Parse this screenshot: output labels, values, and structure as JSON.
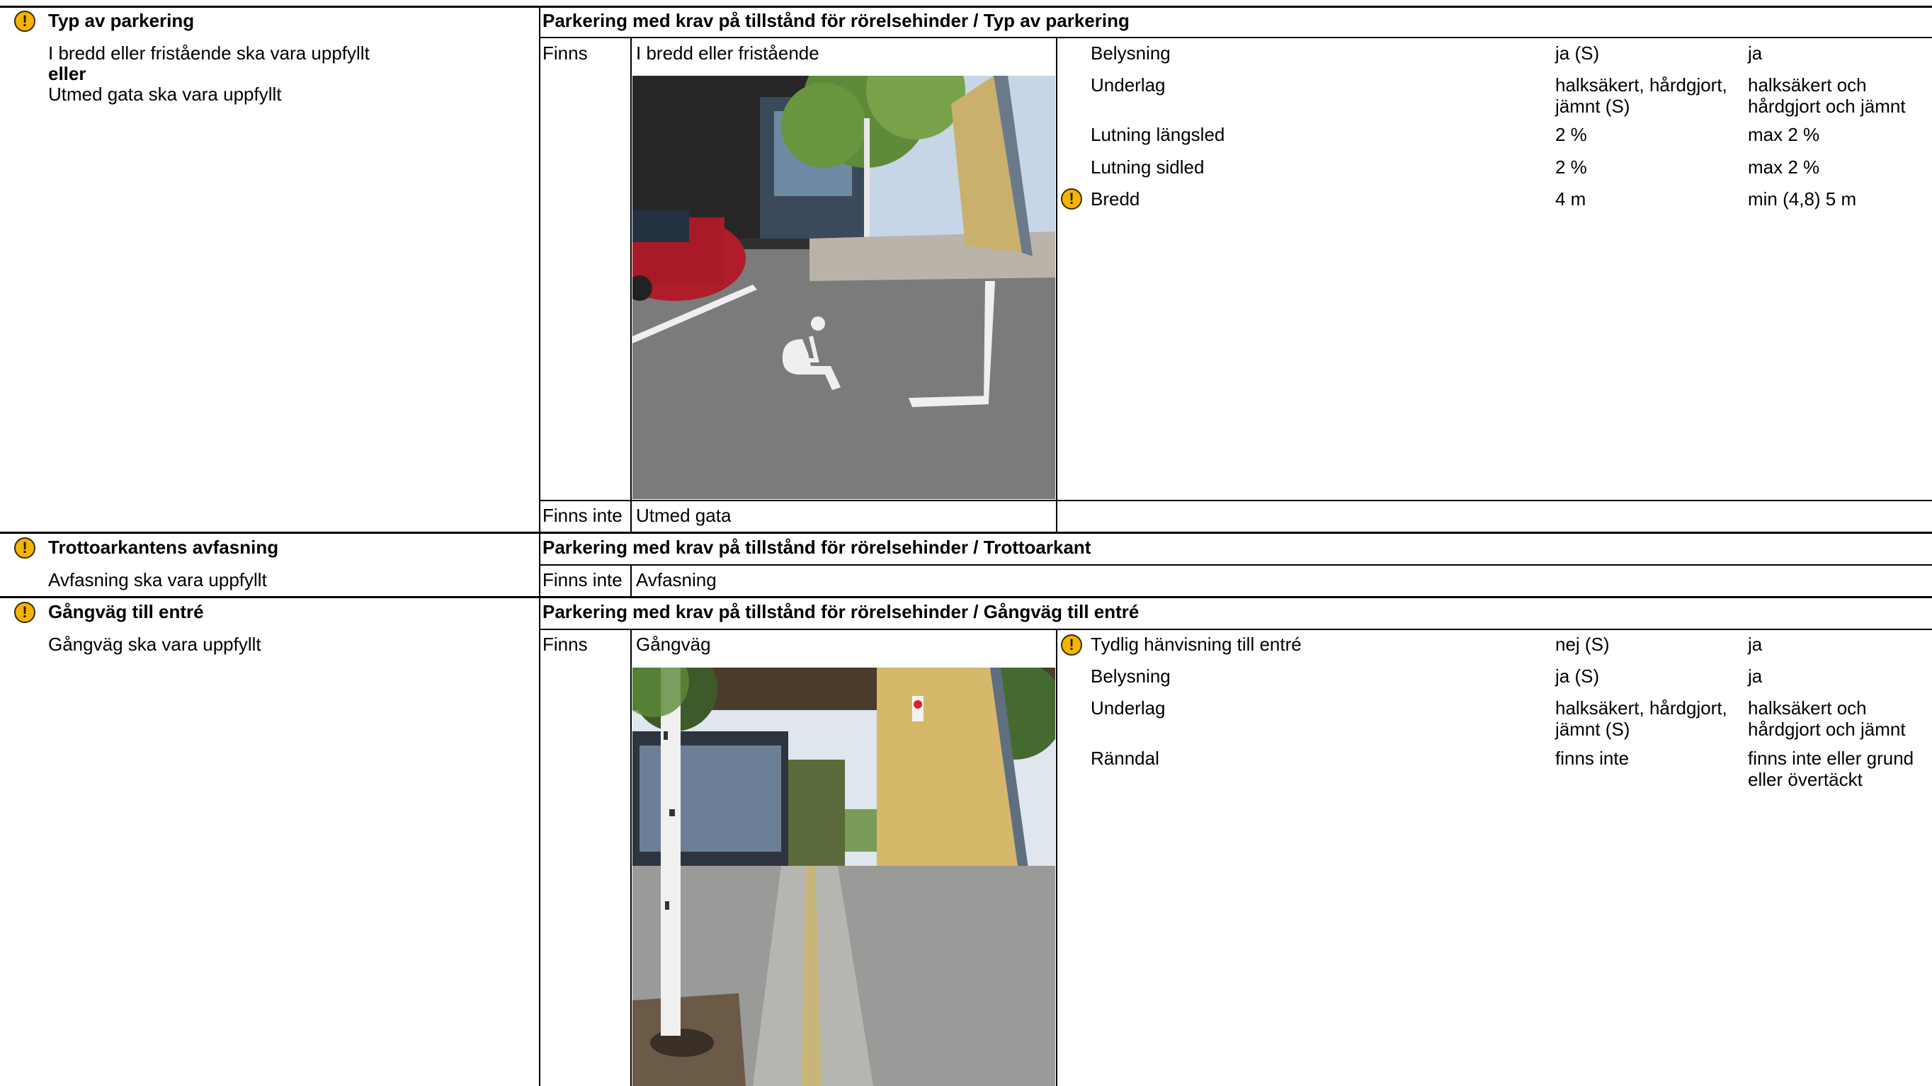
{
  "sections": [
    {
      "title": "Typ av parkering",
      "requirement": {
        "line1": "I bredd eller fristående ska vara uppfyllt",
        "joiner": "eller",
        "line2": "Utmed gata ska vara uppfyllt"
      },
      "header": "Parkering med krav på tillstånd för rörelsehinder / Typ av parkering",
      "rows": [
        {
          "status": "Finns",
          "name": "I bredd eller fristående",
          "photo": "parking-space-photo",
          "details": [
            {
              "label": "Belysning",
              "value": "ja (S)",
              "req": "ja",
              "warn": false
            },
            {
              "label": "Underlag",
              "value": "halksäkert, hårdgjort, jämnt (S)",
              "req": "halksäkert och hårdgjort och jämnt",
              "warn": false
            },
            {
              "label": "Lutning längsled",
              "value": "2 %",
              "req": "max 2 %",
              "warn": false
            },
            {
              "label": "Lutning sidled",
              "value": "2 %",
              "req": "max 2 %",
              "warn": false
            },
            {
              "label": "Bredd",
              "value": "4 m",
              "req": "min (4,8) 5 m",
              "warn": true
            }
          ]
        },
        {
          "status": "Finns inte",
          "name": "Utmed gata"
        }
      ]
    },
    {
      "title": "Trottoarkantens avfasning",
      "requirement": {
        "line1": "Avfasning ska vara uppfyllt"
      },
      "header": "Parkering med krav på tillstånd för rörelsehinder / Trottoarkant",
      "rows": [
        {
          "status": "Finns inte",
          "name": "Avfasning"
        }
      ]
    },
    {
      "title": "Gångväg till entré",
      "requirement": {
        "line1": "Gångväg ska vara uppfyllt"
      },
      "header": "Parkering med krav på tillstånd för rörelsehinder / Gångväg till entré",
      "rows": [
        {
          "status": "Finns",
          "name": "Gångväg",
          "photo": "walkway-photo",
          "details": [
            {
              "label": "Tydlig hänvisning till entré",
              "value": "nej (S)",
              "req": "ja",
              "warn": true
            },
            {
              "label": "Belysning",
              "value": "ja (S)",
              "req": "ja",
              "warn": false
            },
            {
              "label": "Underlag",
              "value": "halksäkert, hårdgjort, jämnt (S)",
              "req": "halksäkert och hårdgjort och jämnt",
              "warn": false
            },
            {
              "label": "Ränndal",
              "value": "finns inte",
              "req": "finns inte eller grund eller övertäckt",
              "warn": false
            }
          ]
        }
      ]
    }
  ],
  "icons": {
    "warning": "warning-icon"
  }
}
